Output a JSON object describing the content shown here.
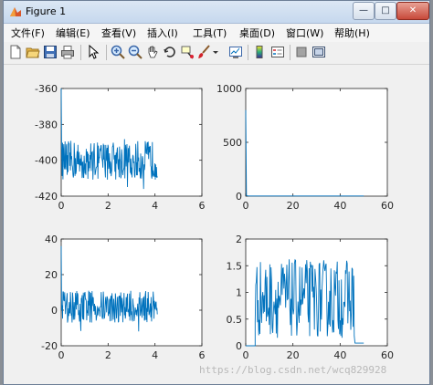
{
  "window": {
    "title": "Figure 1",
    "min_label": "—",
    "max_label": "□",
    "close_label": "✕"
  },
  "menu": [
    {
      "label": "文件(F)"
    },
    {
      "label": "编辑(E)"
    },
    {
      "label": "查看(V)"
    },
    {
      "label": "插入(I)"
    },
    {
      "label": "工具(T)"
    },
    {
      "label": "桌面(D)"
    },
    {
      "label": "窗口(W)"
    },
    {
      "label": "帮助(H)"
    }
  ],
  "toolbar": [
    {
      "icon": "new-figure-icon"
    },
    {
      "icon": "open-file-icon"
    },
    {
      "icon": "save-icon"
    },
    {
      "icon": "print-icon"
    },
    {
      "icon": "pointer-icon"
    },
    {
      "icon": "zoom-in-icon"
    },
    {
      "icon": "zoom-out-icon"
    },
    {
      "icon": "pan-icon"
    },
    {
      "icon": "rotate-3d-icon"
    },
    {
      "icon": "data-cursor-icon"
    },
    {
      "icon": "brush-icon"
    },
    {
      "icon": "link-plot-icon"
    },
    {
      "icon": "colorbar-icon"
    },
    {
      "icon": "legend-icon"
    },
    {
      "icon": "hide-plot-tools-icon"
    },
    {
      "icon": "show-plot-tools-icon"
    }
  ],
  "chart_data": [
    {
      "type": "line",
      "position": "top-left",
      "x_ticks": [
        "0",
        "2",
        "4",
        "6"
      ],
      "y_ticks": [
        "-360",
        "-380",
        "-400",
        "-420"
      ],
      "xlim": [
        0,
        6
      ],
      "ylim": [
        -420,
        -360
      ],
      "y_reversed": true,
      "color": "#0072bd",
      "x_range": [
        0,
        4.1
      ],
      "initial_spike": [
        -360,
        -395
      ],
      "mean": -400,
      "noise_range": [
        -417,
        -388
      ]
    },
    {
      "type": "line",
      "position": "top-right",
      "x_ticks": [
        "0",
        "20",
        "40",
        "60"
      ],
      "y_ticks": [
        "0",
        "500",
        "1000"
      ],
      "xlim": [
        0,
        60
      ],
      "ylim": [
        0,
        1000
      ],
      "color": "#0072bd",
      "x_range": [
        0,
        50
      ],
      "initial_spike": [
        800,
        5
      ],
      "baseline": 2
    },
    {
      "type": "line",
      "position": "bottom-left",
      "x_ticks": [
        "0",
        "2",
        "4",
        "6"
      ],
      "y_ticks": [
        "40",
        "20",
        "0",
        "-20"
      ],
      "xlim": [
        0,
        6
      ],
      "ylim": [
        -20,
        40
      ],
      "color": "#0072bd",
      "x_range": [
        0,
        4.1
      ],
      "initial_spike": [
        36,
        0
      ],
      "mean": 2,
      "noise_range": [
        -12,
        12
      ]
    },
    {
      "type": "line",
      "position": "bottom-right",
      "x_ticks": [
        "0",
        "20",
        "40",
        "60"
      ],
      "y_ticks": [
        "0",
        "0.5",
        "1",
        "1.5",
        "2"
      ],
      "xlim": [
        0,
        60
      ],
      "ylim": [
        0,
        2
      ],
      "color": "#0072bd",
      "x_range": [
        0,
        50
      ],
      "active_range": [
        4,
        46
      ],
      "value_range": [
        0.15,
        1.62
      ]
    }
  ],
  "watermark": "https://blog.csdn.net/wcq829928"
}
